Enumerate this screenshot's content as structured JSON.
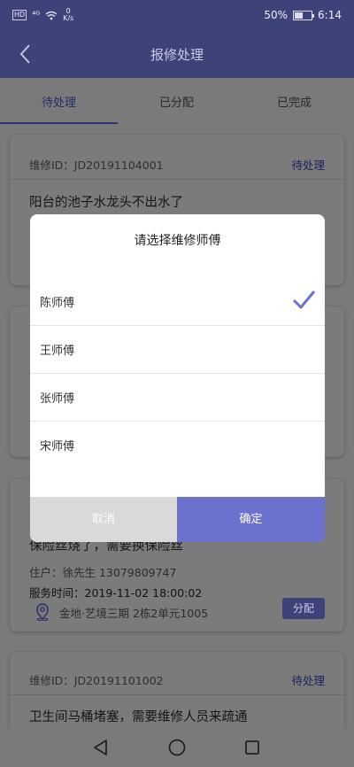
{
  "status_bar": {
    "hd": "HD",
    "network": "⁴ᴳ",
    "speed_value": "0",
    "speed_unit": "K/s",
    "battery_percent": "50%",
    "battery_level": 0.5,
    "time": "6:14"
  },
  "header": {
    "title": "报修处理",
    "back_icon": "chevron-left-icon"
  },
  "tabs": [
    {
      "label": "待处理",
      "active": true
    },
    {
      "label": "已分配",
      "active": false
    },
    {
      "label": "已完成",
      "active": false
    }
  ],
  "cards": [
    {
      "id": "维修ID：JD20191104001",
      "status": "待处理",
      "desc": "阳台的池子水龙头不出水了"
    },
    {
      "desc": "保险丝烧了，需要换保险丝",
      "resident": "住户：徐先生   13079809747",
      "service_time": "服务时间：2019-11-02 18:00:02",
      "address": "金地·艺境三期    2栋2单元1005",
      "assign_label": "分配"
    },
    {
      "id": "维修ID：JD20191101002",
      "status": "待处理",
      "desc": "卫生间马桶堵塞，需要维修人员来疏通"
    }
  ],
  "modal": {
    "title": "请选择维修师傅",
    "options": [
      {
        "label": "陈师傅",
        "selected": true
      },
      {
        "label": "王师傅",
        "selected": false
      },
      {
        "label": "张师傅",
        "selected": false
      },
      {
        "label": "宋师傅",
        "selected": false
      }
    ],
    "cancel_label": "取消",
    "confirm_label": "确定",
    "accent_color": "#6b71cc"
  },
  "nav": {
    "icons": [
      "back-triangle-icon",
      "home-circle-icon",
      "recents-square-icon"
    ]
  }
}
